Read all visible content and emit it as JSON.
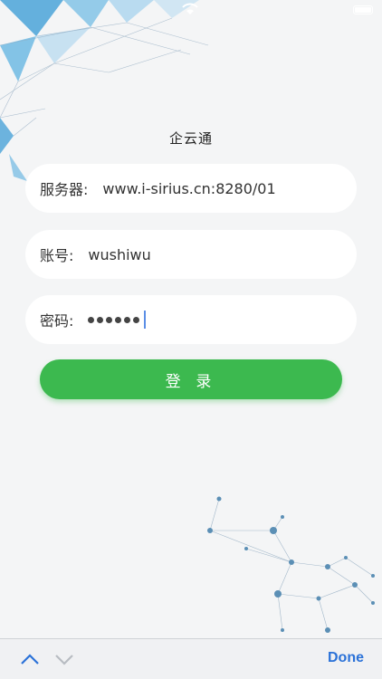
{
  "app": {
    "title": "企云通"
  },
  "form": {
    "server": {
      "label": "服务器:",
      "value": "www.i-sirius.cn:8280/01"
    },
    "account": {
      "label": "账号:",
      "value": "wushiwu"
    },
    "password": {
      "label": "密码:",
      "masked_length": 6
    }
  },
  "actions": {
    "login_label": "登 录"
  },
  "keyboard_toolbar": {
    "done_label": "Done"
  },
  "colors": {
    "accent": "#3cb94f",
    "link": "#2b72d8",
    "background": "#f4f5f6"
  }
}
